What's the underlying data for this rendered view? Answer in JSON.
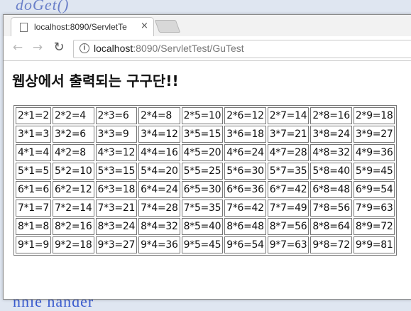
{
  "background": {
    "top_text": "doGet()",
    "bottom_text": "nhie hander"
  },
  "browser": {
    "tab": {
      "title": "localhost:8090/ServletTe",
      "close": "×"
    },
    "nav": {
      "back": "←",
      "forward": "→",
      "reload": "↻"
    },
    "address": {
      "host": "localhost",
      "path": ":8090/ServletTest/GuTest"
    }
  },
  "page": {
    "heading": "웹상에서 출력되는 구구단!!",
    "table": [
      [
        "2*1=2",
        "2*2=4",
        "2*3=6",
        "2*4=8",
        "2*5=10",
        "2*6=12",
        "2*7=14",
        "2*8=16",
        "2*9=18"
      ],
      [
        "3*1=3",
        "3*2=6",
        "3*3=9",
        "3*4=12",
        "3*5=15",
        "3*6=18",
        "3*7=21",
        "3*8=24",
        "3*9=27"
      ],
      [
        "4*1=4",
        "4*2=8",
        "4*3=12",
        "4*4=16",
        "4*5=20",
        "4*6=24",
        "4*7=28",
        "4*8=32",
        "4*9=36"
      ],
      [
        "5*1=5",
        "5*2=10",
        "5*3=15",
        "5*4=20",
        "5*5=25",
        "5*6=30",
        "5*7=35",
        "5*8=40",
        "5*9=45"
      ],
      [
        "6*1=6",
        "6*2=12",
        "6*3=18",
        "6*4=24",
        "6*5=30",
        "6*6=36",
        "6*7=42",
        "6*8=48",
        "6*9=54"
      ],
      [
        "7*1=7",
        "7*2=14",
        "7*3=21",
        "7*4=28",
        "7*5=35",
        "7*6=42",
        "7*7=49",
        "7*8=56",
        "7*9=63"
      ],
      [
        "8*1=8",
        "8*2=16",
        "8*3=24",
        "8*4=32",
        "8*5=40",
        "8*6=48",
        "8*7=56",
        "8*8=64",
        "8*9=72"
      ],
      [
        "9*1=9",
        "9*2=18",
        "9*3=27",
        "9*4=36",
        "9*5=45",
        "9*6=54",
        "9*7=63",
        "9*8=72",
        "9*9=81"
      ]
    ]
  }
}
